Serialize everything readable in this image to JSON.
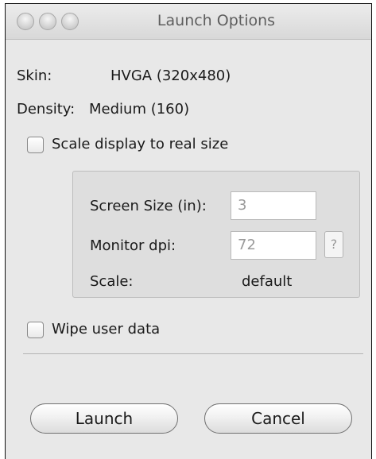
{
  "window": {
    "title": "Launch Options"
  },
  "info": {
    "skin_label": "Skin:",
    "skin_value": "HVGA (320x480)",
    "density_label": "Density:",
    "density_value": "Medium (160)"
  },
  "scale_checkbox": {
    "label": "Scale display to real size",
    "checked": false
  },
  "scale_group": {
    "screen_size_label": "Screen Size (in):",
    "screen_size_value": "3",
    "monitor_dpi_label": "Monitor dpi:",
    "monitor_dpi_value": "72",
    "help_label": "?",
    "scale_label": "Scale:",
    "scale_value": "default"
  },
  "wipe_checkbox": {
    "label": "Wipe user data",
    "checked": false
  },
  "buttons": {
    "launch_label": "Launch",
    "cancel_label": "Cancel"
  }
}
